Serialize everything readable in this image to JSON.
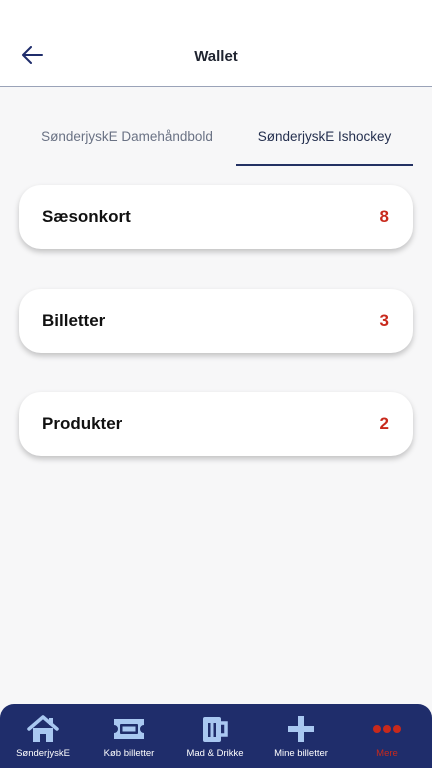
{
  "header": {
    "title": "Wallet",
    "back_icon": "arrow-left-icon"
  },
  "tabs": [
    {
      "label": "SønderjyskE Damehåndbold",
      "selected": false
    },
    {
      "label": "SønderjyskE Ishockey",
      "selected": true
    }
  ],
  "cards": [
    {
      "label": "Sæsonkort",
      "count": "8"
    },
    {
      "label": "Billetter",
      "count": "3"
    },
    {
      "label": "Produkter",
      "count": "2"
    }
  ],
  "bottom_nav": [
    {
      "label": "SønderjyskE",
      "icon": "home-icon"
    },
    {
      "label": "Køb billetter",
      "icon": "ticket-icon"
    },
    {
      "label": "Mad & Drikke",
      "icon": "beer-mug-icon"
    },
    {
      "label": "Mine billetter",
      "icon": "plus-icon"
    },
    {
      "label": "Mere",
      "icon": "more-dots-icon",
      "active": true
    }
  ],
  "colors": {
    "navy": "#1f2d6b",
    "accent_red": "#c8291c",
    "icon_light_blue": "#a9c8f1",
    "background": "#f7f7f8"
  }
}
